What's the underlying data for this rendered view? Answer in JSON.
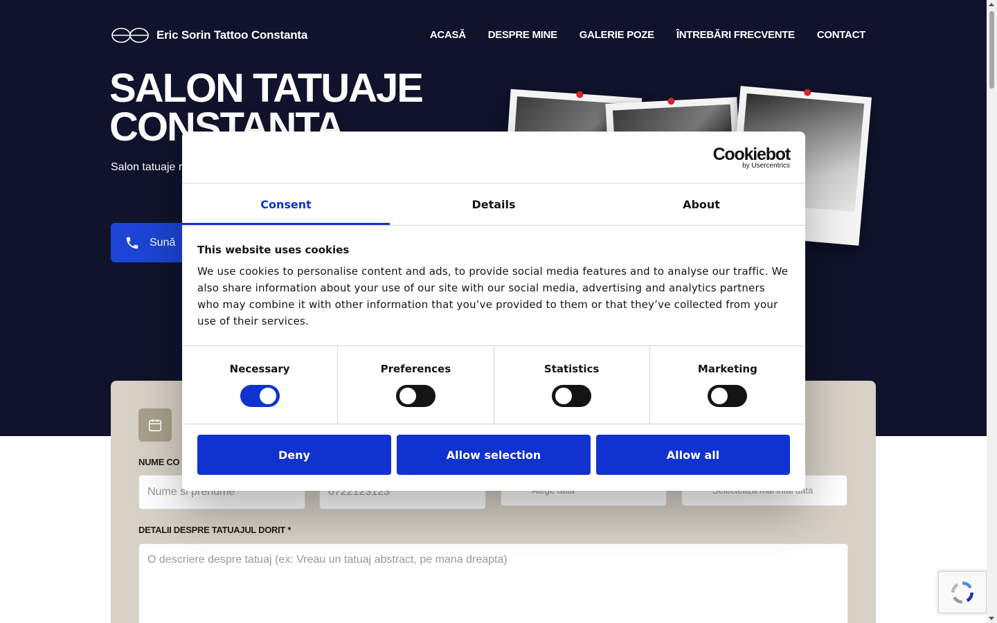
{
  "site": {
    "brand_name": "Eric Sorin Tattoo Constanta",
    "nav": [
      "ACASĂ",
      "DESPRE MINE",
      "GALERIE POZE",
      "ÎNTREBĂRI FRECVENTE",
      "CONTACT"
    ]
  },
  "hero": {
    "title": "SALON TATUAJE CONSTANTA",
    "subtitle": "Salon tatuaje realizează tatu profesionalism",
    "call_label": "Sună"
  },
  "form": {
    "name_label": "NUME CO",
    "name_placeholder": "Nume si prenume",
    "phone_placeholder": "0722123123",
    "date_placeholder": "Alege data",
    "time_placeholder": "Selecteaza mai intai data",
    "details_label": "DETALII DESPRE TATUAJUL DORIT *",
    "details_placeholder": "O descriere despre tatuaj (ex: Vreau un tatuaj abstract, pe mana dreapta)"
  },
  "cookie_dialog": {
    "logo_main": "Cookiebot",
    "logo_sub": "by Usercentrics",
    "tabs": [
      "Consent",
      "Details",
      "About"
    ],
    "active_tab": "Consent",
    "heading": "This website uses cookies",
    "body": "We use cookies to personalise content and ads, to provide social media features and to analyse our traffic. We also share information about your use of our site with our social media, advertising and analytics partners who may combine it with other information that you’ve provided to them or that they’ve collected from your use of their services.",
    "categories": [
      {
        "label": "Necessary",
        "enabled": true
      },
      {
        "label": "Preferences",
        "enabled": false
      },
      {
        "label": "Statistics",
        "enabled": false
      },
      {
        "label": "Marketing",
        "enabled": false
      }
    ],
    "buttons": {
      "deny": "Deny",
      "allow_selection": "Allow selection",
      "allow_all": "Allow all"
    },
    "accent_color": "#1032cf"
  },
  "colors": {
    "hero_bg": "#10132b",
    "call_button": "#1c45d6",
    "form_card_bg": "#d7d1c6"
  }
}
